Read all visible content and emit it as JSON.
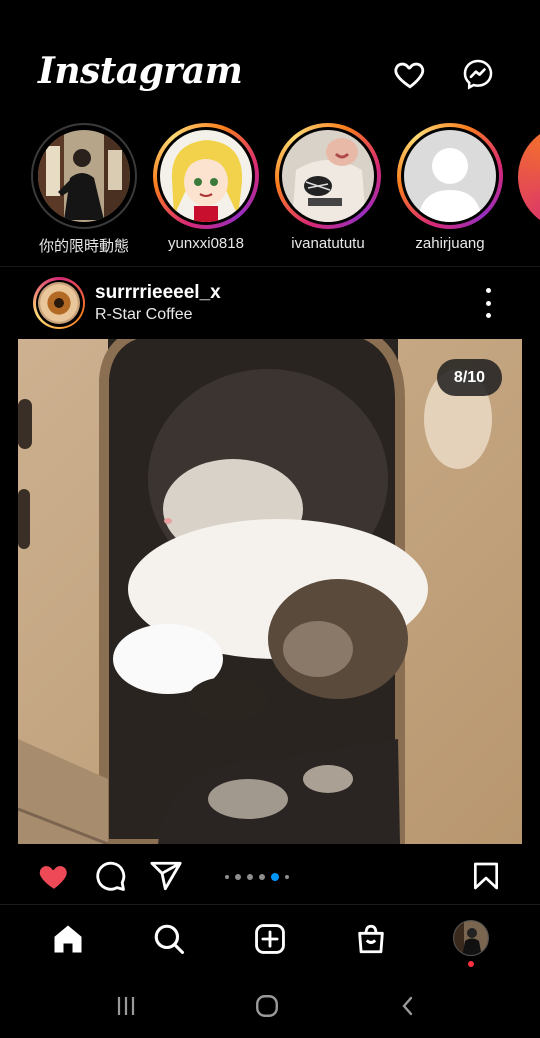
{
  "app": {
    "logo_text": "Instagram"
  },
  "colors": {
    "background": "#000000",
    "like_red": "#ed4956",
    "story_ring": [
      "#d62976",
      "#fa7e1e",
      "#feda75"
    ],
    "active_dot": "#0095f6",
    "notification": "#ff3040"
  },
  "header": {
    "icons": [
      "heart-icon",
      "messenger-icon"
    ]
  },
  "stories": [
    {
      "label": "你的限時動態",
      "ring": "seen"
    },
    {
      "label": "yunxxi0818",
      "ring": "unseen"
    },
    {
      "label": "ivanatututu",
      "ring": "unseen"
    },
    {
      "label": "zahirjuang",
      "ring": "unseen"
    }
  ],
  "post": {
    "username": "surrrrieeeel_x",
    "location": "R-Star Coffee",
    "image_counter": "8/10",
    "carousel": {
      "total_dots": 6,
      "active_index": 4
    },
    "liked": true
  },
  "actions": {
    "icons": [
      "heart-filled-icon",
      "comment-icon",
      "share-icon",
      "bookmark-icon"
    ]
  },
  "tabbar": {
    "icons": [
      "home-icon",
      "search-icon",
      "create-icon",
      "shop-icon",
      "profile-avatar"
    ],
    "active": "home"
  },
  "system_nav": {
    "icons": [
      "recent-apps-icon",
      "home-button-icon",
      "back-icon"
    ]
  }
}
